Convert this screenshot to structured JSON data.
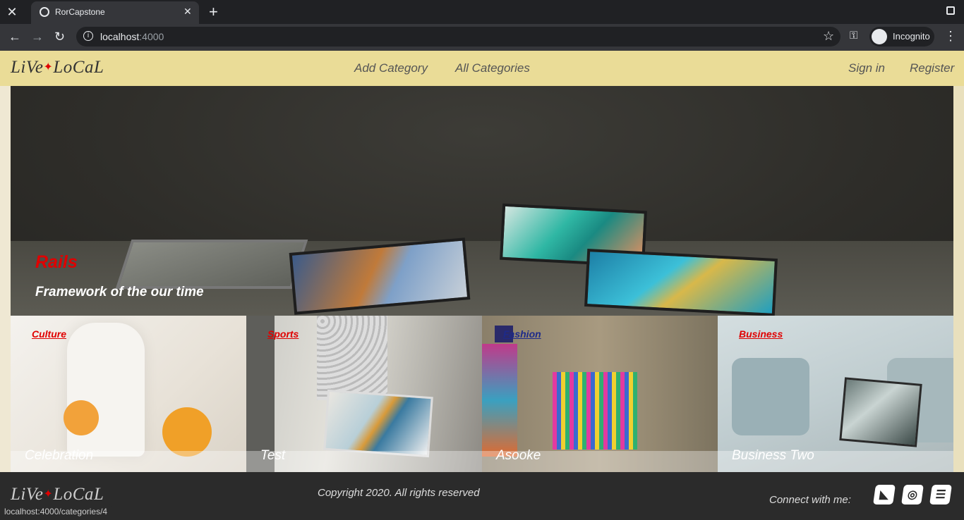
{
  "browser": {
    "tab_title": "RorCapstone",
    "url_host": "localhost",
    "url_port": ":4000",
    "profile_label": "Incognito",
    "status_url": "localhost:4000/categories/4"
  },
  "site": {
    "logo_left": "LiVe",
    "logo_right": "LoCaL",
    "logo_star": "✦",
    "nav": {
      "add_category": "Add Category",
      "all_categories": "All Categories",
      "sign_in": "Sign in",
      "register": "Register"
    },
    "hero": {
      "category": "Rails",
      "title": "Framework of the our time"
    },
    "cards": [
      {
        "category": "Culture",
        "title": "Celebration",
        "category_color": "#e00000"
      },
      {
        "category": "Sports",
        "title": "Test",
        "category_color": "#e00000"
      },
      {
        "category": "Fashion",
        "title": "Asooke",
        "category_color": "#1d2a8a"
      },
      {
        "category": "Business",
        "title": "Business Two",
        "category_color": "#e00000"
      }
    ],
    "footer": {
      "copyright": "Copyright 2020. All rights reserved",
      "connect": "Connect with me:"
    }
  },
  "colors": {
    "nav_bg": "#eadc97",
    "accent": "#e00000",
    "footer_bg": "#2b2b2b"
  }
}
